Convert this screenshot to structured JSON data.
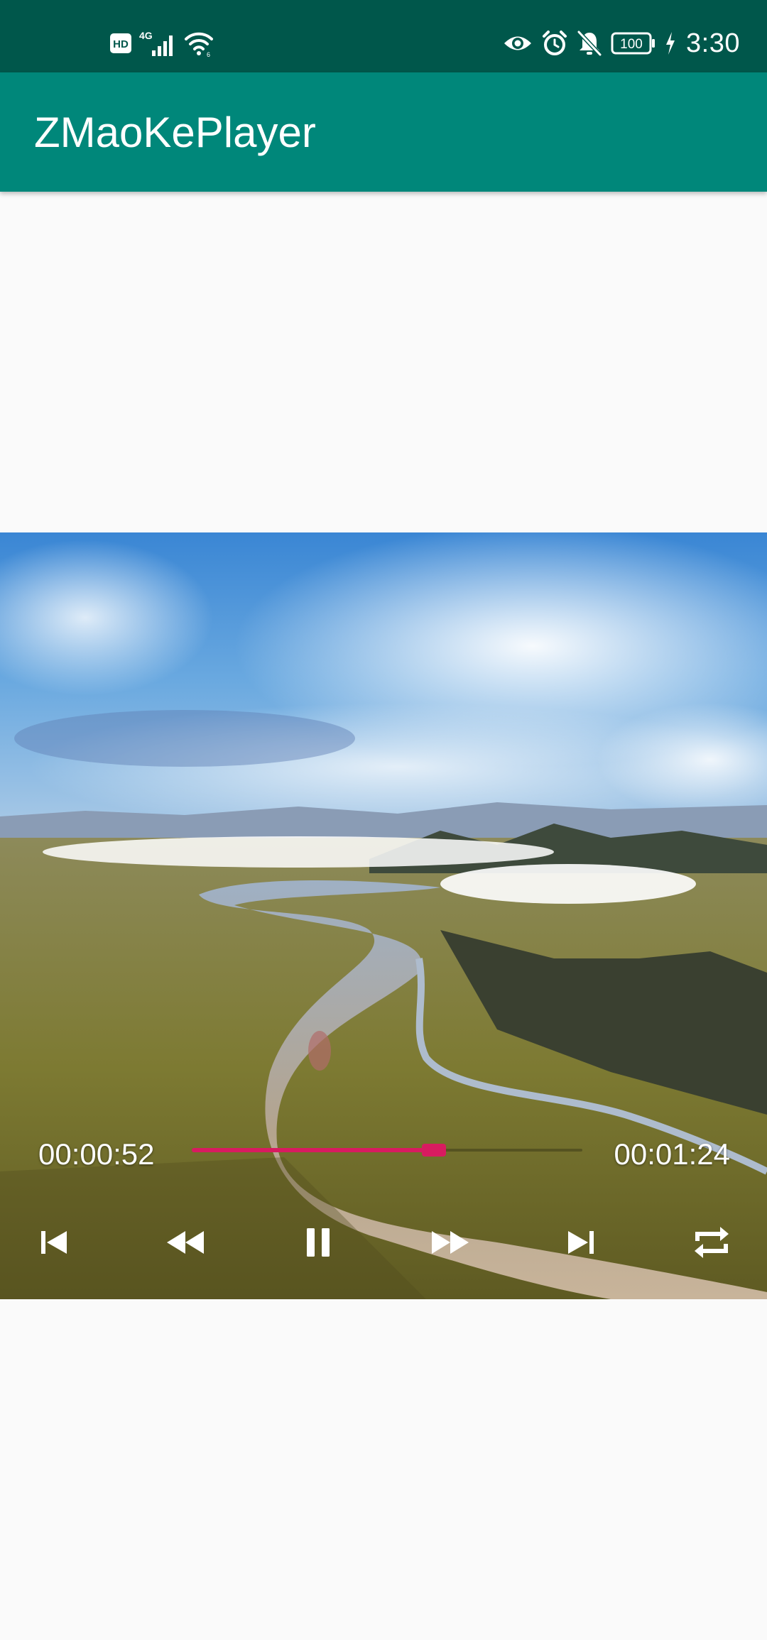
{
  "status_bar": {
    "time": "3:30",
    "battery_level": "100",
    "network_type": "4G",
    "icons": [
      "hd-icon",
      "signal-icon",
      "wifi-icon",
      "eye-icon",
      "alarm-icon",
      "bell-off-icon",
      "battery-icon",
      "charging-icon"
    ]
  },
  "app_bar": {
    "title": "ZMaoKePlayer"
  },
  "player": {
    "current_time": "00:00:52",
    "total_time": "00:01:24",
    "progress_fraction": 0.62,
    "colors": {
      "accent": "#d81b60",
      "app_bar": "#00877a",
      "status_bar": "#00574b"
    },
    "control_icons": [
      "skip-previous-icon",
      "rewind-icon",
      "pause-icon",
      "fast-forward-icon",
      "skip-next-icon",
      "repeat-icon"
    ]
  }
}
